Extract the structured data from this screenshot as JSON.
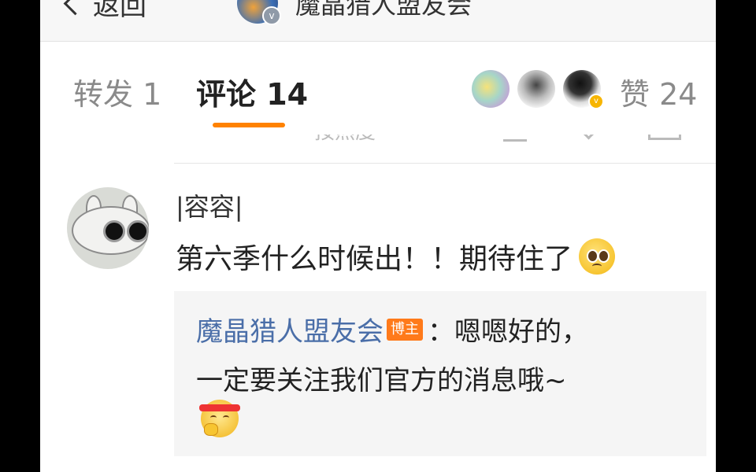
{
  "topbar": {
    "back_label": "返回",
    "title": "魔晶猎人盟友会",
    "verified_badge": "v"
  },
  "tabs": {
    "forward_label": "转发 1",
    "comment_label": "评论 14",
    "likes_label": "赞 24",
    "liker_badge": "v"
  },
  "sort": {
    "label": "按热度"
  },
  "comment": {
    "author": "|容容|",
    "text": "第六季什么时候出！！期待住了",
    "text_emoji": "pleading-face",
    "reply": {
      "author": "魔晶猎人盟友会",
      "badge": "博主",
      "line1_text": "：嗯嗯好的，",
      "line2_text": "一定要关注我们官方的消息哦~",
      "emoji": "working-hard-face"
    }
  },
  "colors": {
    "accent": "#ff8200",
    "link": "#4a6ea8",
    "badge": "#ff7a1a"
  }
}
